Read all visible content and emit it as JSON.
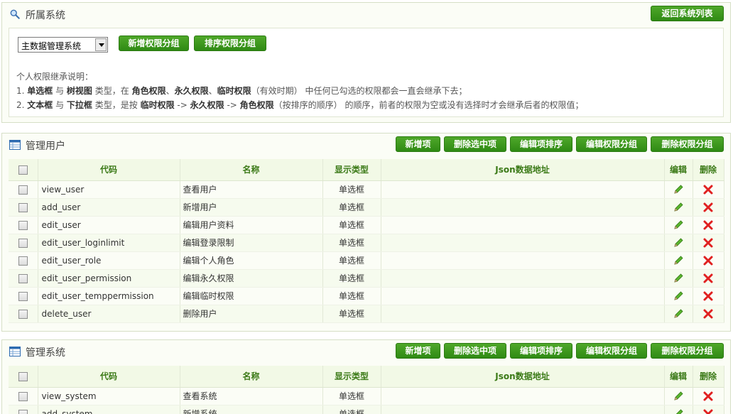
{
  "system": {
    "title": "所属系统",
    "back_label": "返回系统列表",
    "selected_system": "主数据管理系统",
    "add_group_label": "新增权限分组",
    "sort_group_label": "排序权限分组",
    "desc_title": "个人权限继承说明：",
    "desc1": {
      "n": "1. ",
      "b1": "单选框",
      "t1": " 与 ",
      "b2": "树视图",
      "t2": " 类型，在 ",
      "b3": "角色权限",
      "t3": "、",
      "b4": "永久权限",
      "t4": "、",
      "b5": "临时权限",
      "t5": "（有效时期） 中任何已勾选的权限都会一直会继承下去；"
    },
    "desc2": {
      "n": "2. ",
      "b1": "文本框",
      "t1": " 与 ",
      "b2": "下拉框",
      "t2": " 类型，是按 ",
      "b3": "临时权限",
      "t3": " -> ",
      "b4": "永久权限",
      "t4": " -> ",
      "b5": "角色权限",
      "t5": "（按排序的顺序） 的顺序，前者的权限为空或没有选择时才会继承后者的权限值；"
    }
  },
  "toolbar": {
    "add_item": "新增项",
    "delete_selected": "删除选中项",
    "sort_items": "编辑项排序",
    "edit_group": "编辑权限分组",
    "delete_group": "删除权限分组"
  },
  "columns": {
    "code": "代码",
    "name": "名称",
    "type": "显示类型",
    "json": "Json数据地址",
    "edit": "编辑",
    "delete": "删除"
  },
  "group1": {
    "title": "管理用户",
    "rows": [
      {
        "code": "view_user",
        "name": "查看用户",
        "type": "单选框",
        "json": ""
      },
      {
        "code": "add_user",
        "name": "新增用户",
        "type": "单选框",
        "json": ""
      },
      {
        "code": "edit_user",
        "name": "编辑用户资料",
        "type": "单选框",
        "json": ""
      },
      {
        "code": "edit_user_loginlimit",
        "name": "编辑登录限制",
        "type": "单选框",
        "json": ""
      },
      {
        "code": "edit_user_role",
        "name": "编辑个人角色",
        "type": "单选框",
        "json": ""
      },
      {
        "code": "edit_user_permission",
        "name": "编辑永久权限",
        "type": "单选框",
        "json": ""
      },
      {
        "code": "edit_user_temppermission",
        "name": "编辑临时权限",
        "type": "单选框",
        "json": ""
      },
      {
        "code": "delete_user",
        "name": "删除用户",
        "type": "单选框",
        "json": ""
      }
    ]
  },
  "group2": {
    "title": "管理系统",
    "rows": [
      {
        "code": "view_system",
        "name": "查看系统",
        "type": "单选框",
        "json": ""
      },
      {
        "code": "add_system",
        "name": "新增系统",
        "type": "单选框",
        "json": ""
      }
    ]
  },
  "icons": {
    "edit": "pencil-icon",
    "delete": "red-x-icon",
    "search": "magnifier-icon",
    "table": "table-icon"
  },
  "colors": {
    "button": "#3a9a1c",
    "header_text": "#3b7a17",
    "delete": "#e02020"
  }
}
